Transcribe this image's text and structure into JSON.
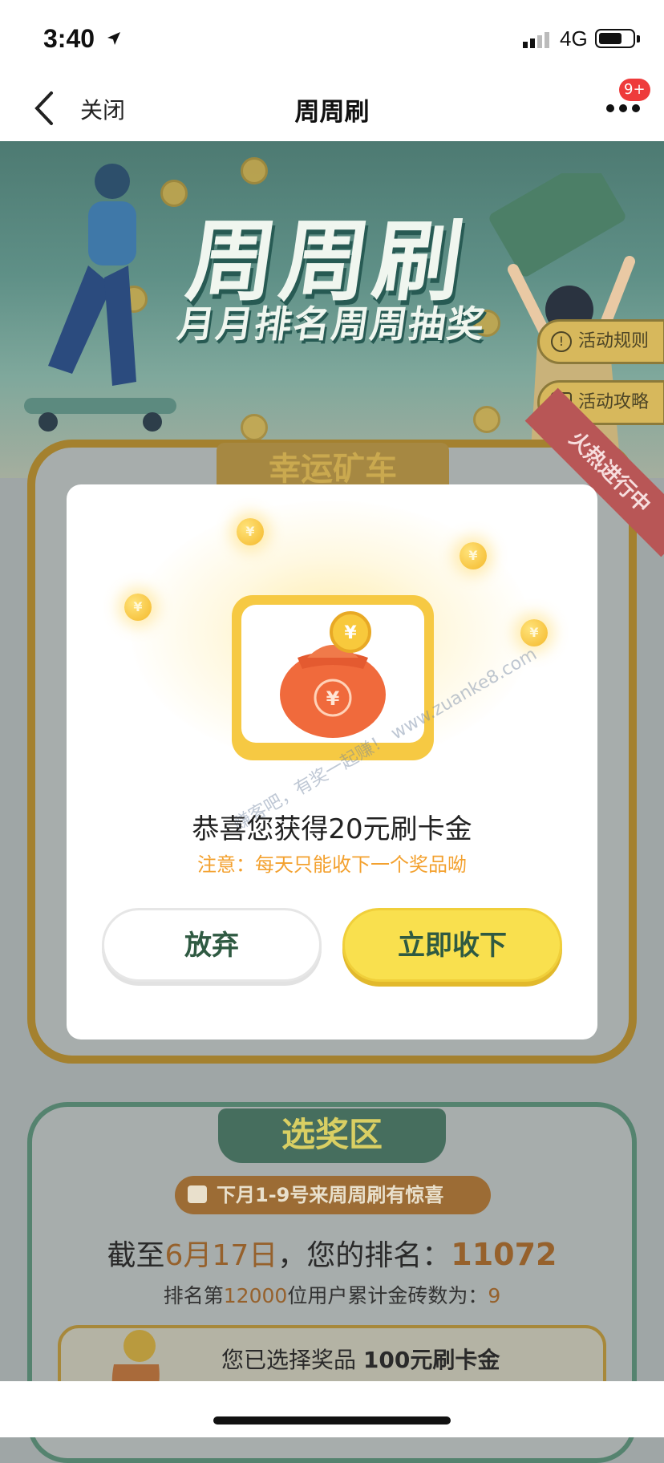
{
  "status_bar": {
    "time": "3:40",
    "network": "4G"
  },
  "nav": {
    "close_label": "关闭",
    "title": "周周刷",
    "badge": "9+"
  },
  "hero": {
    "title": "周周刷",
    "subtitle": "月月排名周周抽奖",
    "rules_label": "活动规则",
    "guide_label": "活动攻略"
  },
  "mine_section": {
    "tab_label": "幸运矿车",
    "ribbon_label": "火热进行中"
  },
  "modal": {
    "congrats_text": "恭喜您获得20元刷卡金",
    "notice_text": "注意：每天只能收下一个奖品呦",
    "abandon_label": "放弃",
    "accept_label": "立即收下",
    "coin_symbol": "¥",
    "watermark": "赚客吧，有奖一起赚！ www.zuanke8.com"
  },
  "select_section": {
    "tab_label": "选奖区",
    "promo_text": "下月1-9号来周周刷有惊喜",
    "rank_prefix": "截至",
    "rank_date": "6月17日",
    "rank_mid": "，您的排名：",
    "rank_value": "11072",
    "brick_prefix": "排名第",
    "brick_rank": "12000",
    "brick_mid": "位用户累计金砖数为：",
    "brick_value": "9",
    "chosen_prefix": "您已选择奖品",
    "chosen_prize": "100元刷卡金"
  },
  "colors": {
    "accent_yellow": "#f9e04e",
    "button_text": "#2f5a42",
    "notice_orange": "#f3a12f"
  }
}
